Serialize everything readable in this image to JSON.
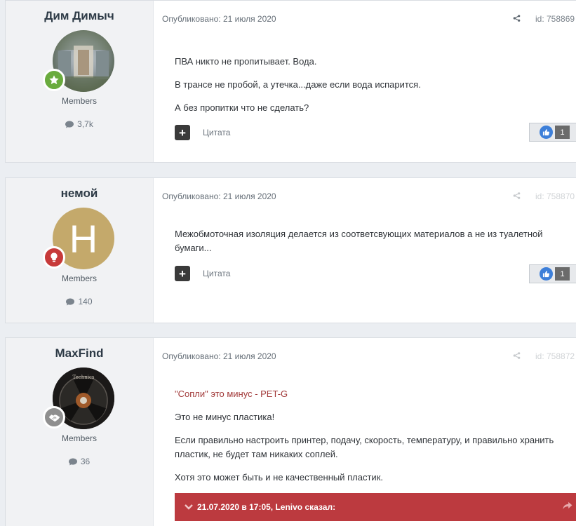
{
  "posts": [
    {
      "author": "Дим Димыч",
      "group": "Members",
      "post_count": "3,7k",
      "date": "Опубликовано: 21 июля 2020",
      "id_label": "id: 758869",
      "paragraphs": [
        "ПВА никто не пропитывает. Вода.",
        "В трансе не пробой,  а утечка...даже если вода испарится.",
        "А без пропитки что не сделать?"
      ],
      "quote_label": "Цитата",
      "reaction_count": "1",
      "rank_icon": "star-icon",
      "rank_color": "#6aab3e"
    },
    {
      "author": "немой",
      "group": "Members",
      "post_count": "140",
      "date": "Опубликовано: 21 июля 2020",
      "id_label": "id: 758870",
      "avatar_letter": "H",
      "avatar_color": "#c4a96b",
      "paragraphs": [
        "Межобмоточная изоляция делается из соответсвующих материалов а не из туалетной бумаги..."
      ],
      "quote_label": "Цитата",
      "reaction_count": "1",
      "rank_icon": "lightbulb-icon",
      "rank_color": "#c73a3a"
    },
    {
      "author": "MaxFind",
      "group": "Members",
      "post_count": "36",
      "date": "Опубликовано: 21 июля 2020",
      "id_label": "id: 758872",
      "quoted_link": "\"Сопли\" это минус - PET-G",
      "avatar_brand": "Technics",
      "paragraphs": [
        "Это не минус пластика!",
        "Если правильно настроить принтер, подачу, скорость, температуру, и правильно хранить пластик, не будет там никаких соплей.",
        "Хотя это может быть и не качественный пластик."
      ],
      "quote_header": "21.07.2020 в 17:05, Lenivo сказал:",
      "rank_icon": "handshake-icon",
      "rank_color": "#8f8f8f"
    }
  ],
  "colors": {
    "page_bg": "#ebeef2",
    "author_panel_bg": "#f1f2f4",
    "quote_bar": "#bc3a3f",
    "like_blue": "#3d7fd9"
  }
}
